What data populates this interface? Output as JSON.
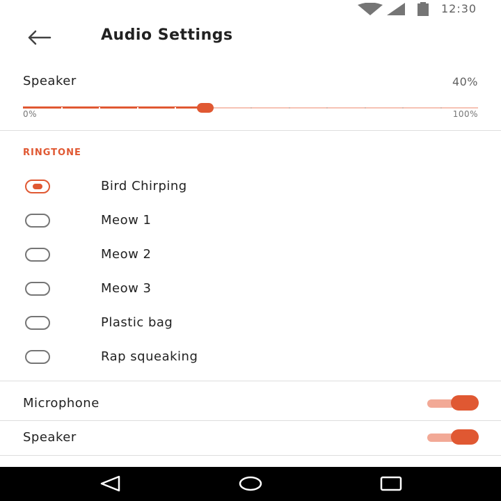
{
  "status_bar": {
    "time": "12:30",
    "icons": [
      "wifi-icon",
      "cellular-signal-icon",
      "battery-icon"
    ]
  },
  "app_bar": {
    "title": "Audio Settings",
    "back_icon": "arrow-left-icon"
  },
  "speaker_volume": {
    "label": "Speaker",
    "value_text": "40%",
    "value": 40,
    "min_label": "0%",
    "max_label": "100%",
    "ticks": 12
  },
  "ringtone": {
    "header": "RINGTONE",
    "selected": "Bird Chirping",
    "options": [
      {
        "label": "Bird Chirping",
        "checked": true
      },
      {
        "label": "Meow 1",
        "checked": false
      },
      {
        "label": "Meow 2",
        "checked": false
      },
      {
        "label": "Meow 3",
        "checked": false
      },
      {
        "label": "Plastic bag",
        "checked": false
      },
      {
        "label": "Rap squeaking",
        "checked": false
      }
    ]
  },
  "toggles": [
    {
      "label": "Microphone",
      "on": true
    },
    {
      "label": "Speaker",
      "on": true
    }
  ],
  "nav_bar": {
    "icons": [
      "back-triangle-icon",
      "home-circle-icon",
      "recents-square-icon"
    ]
  },
  "colors": {
    "accent": "#e05832",
    "accent_light": "#f2a996",
    "divider": "#dddddd",
    "nav_background": "#000000"
  }
}
